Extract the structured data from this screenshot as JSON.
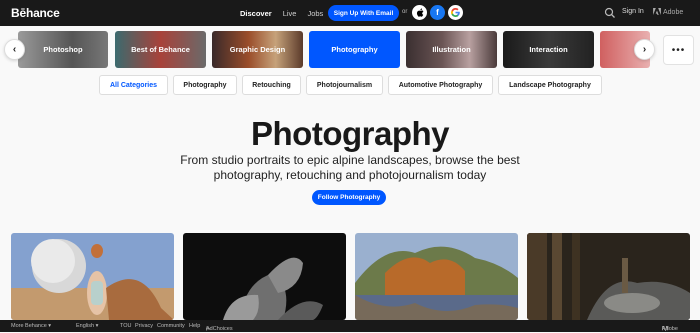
{
  "header": {
    "logo": "Bēhance",
    "nav": [
      "Discover",
      "Live",
      "Jobs"
    ],
    "signup_label": "Sign Up With Email",
    "or_label": "or",
    "social": [
      "apple",
      "facebook",
      "google"
    ],
    "signin_label": "Sign In",
    "adobe_label": "Adobe"
  },
  "categories": [
    {
      "label": "Photoshop",
      "color": "#6c6c6c"
    },
    {
      "label": "Best of Behance",
      "color": "#a8423a"
    },
    {
      "label": "Graphic Design",
      "color": "#8a3e2a"
    },
    {
      "label": "Photography",
      "color": "#0057ff"
    },
    {
      "label": "Illustration",
      "color": "#5a4a4a"
    },
    {
      "label": "Interaction",
      "color": "#2a2a2a"
    }
  ],
  "filters": [
    "All Categories",
    "Photography",
    "Retouching",
    "Photojournalism",
    "Automotive Photography",
    "Landscape Photography"
  ],
  "hero": {
    "title": "Photography",
    "subtitle": "From studio portraits to epic alpine landscapes, browse the best photography, retouching and photojournalism today",
    "follow_label": "Follow Photography"
  },
  "projects": [
    {
      "name": "portrait-with-moon",
      "color": "#7b99c8"
    },
    {
      "name": "dark-flower",
      "color": "#111111"
    },
    {
      "name": "mountain-lake",
      "color": "#7a8aa8"
    },
    {
      "name": "car-in-forest",
      "color": "#3a3228"
    }
  ],
  "footer": {
    "more": "More Behance ▾",
    "language": "English ▾",
    "links": [
      "TOU",
      "Privacy",
      "Community",
      "Help"
    ],
    "adchoices": "AdChoices",
    "adobe": "Adobe"
  }
}
